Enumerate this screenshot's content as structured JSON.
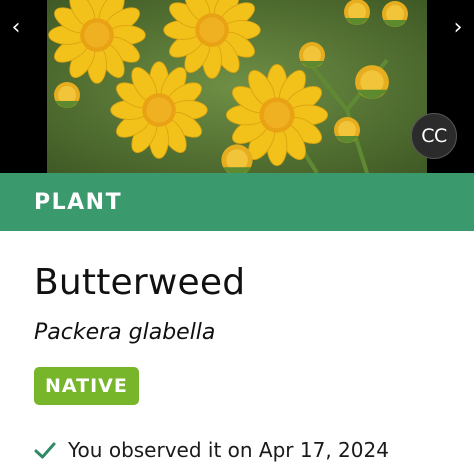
{
  "photo": {
    "license_badge": "CC"
  },
  "nav": {
    "prev_glyph": "‹",
    "next_glyph": "›"
  },
  "category": {
    "label": "PLANT",
    "color": "#3a9a6e"
  },
  "species": {
    "common_name": "Butterweed",
    "scientific_name": "Packera glabella"
  },
  "status": {
    "badge_label": "NATIVE",
    "badge_color": "#77b52b"
  },
  "observation": {
    "text": "You observed it on Apr 17, 2024",
    "icon": "check-icon",
    "icon_color": "#2e8b63"
  }
}
